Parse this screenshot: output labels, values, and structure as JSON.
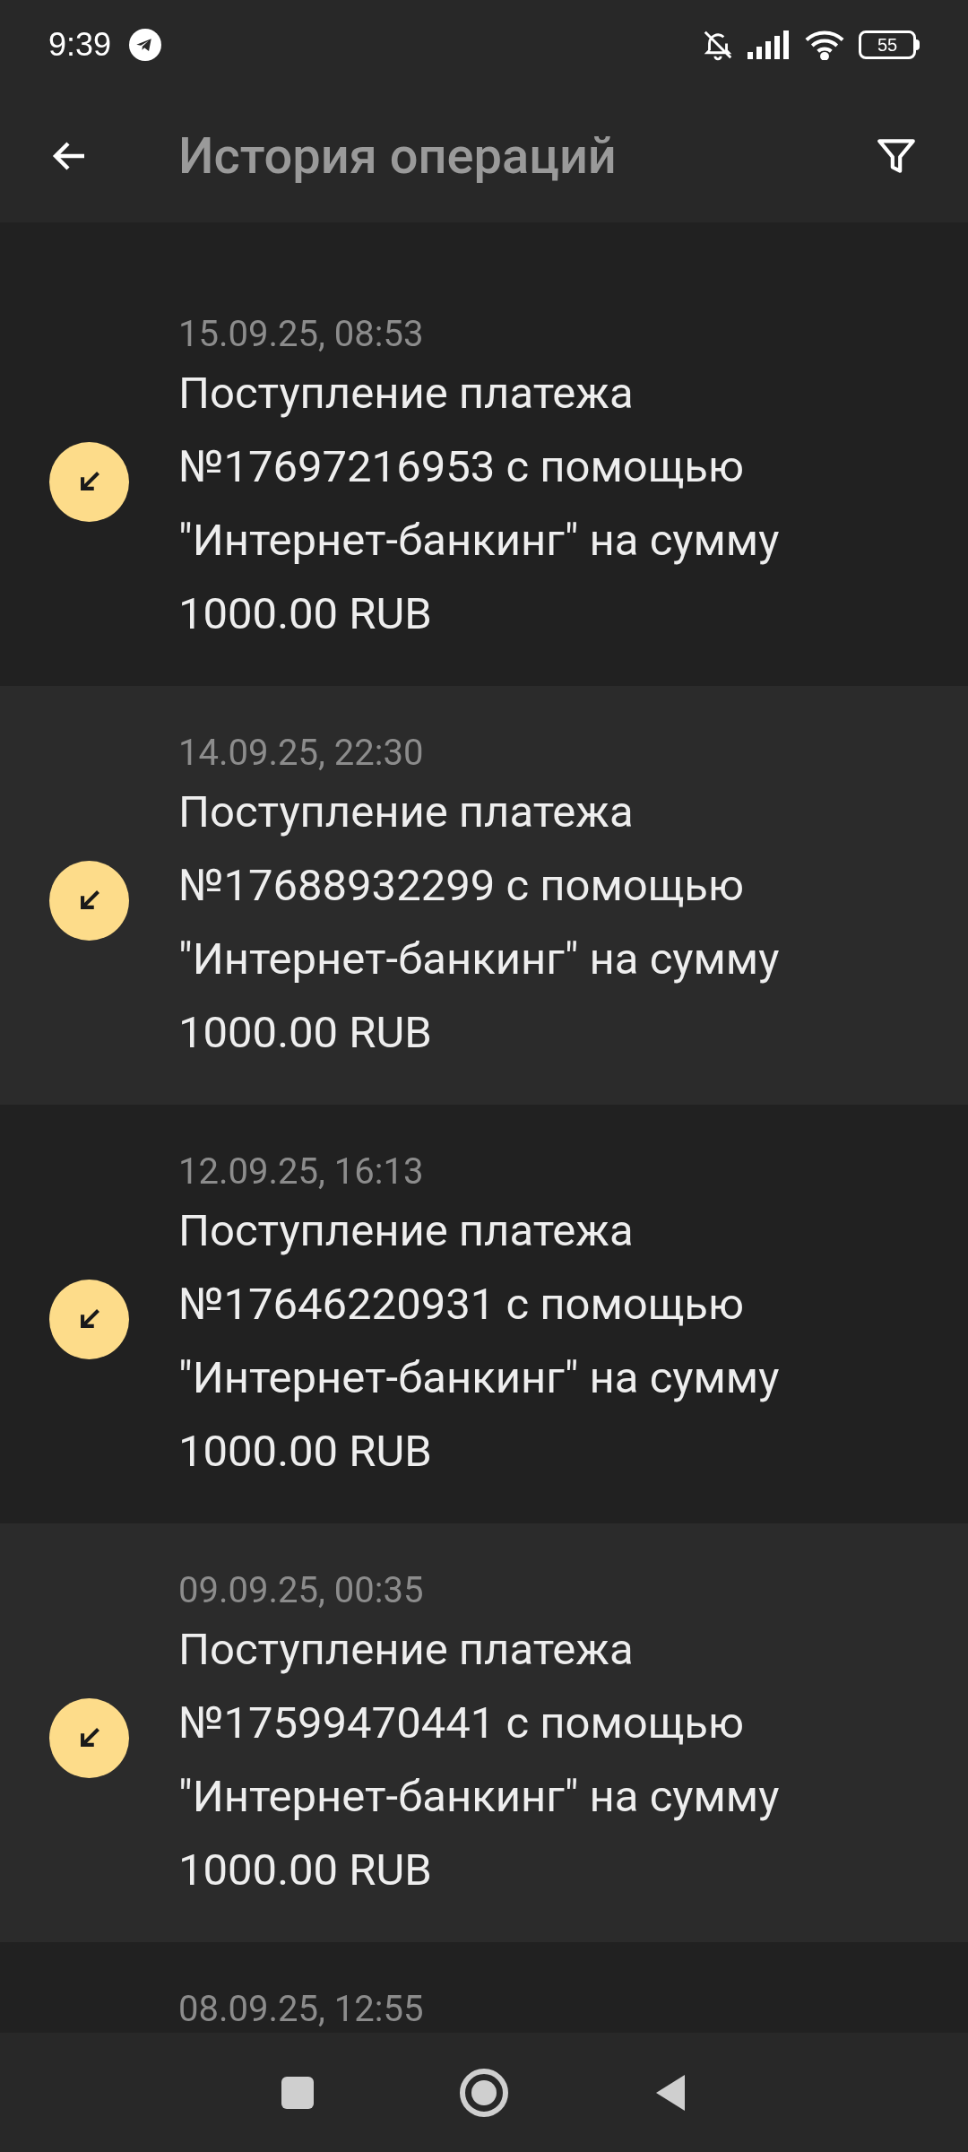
{
  "status_bar": {
    "time": "9:39",
    "battery": "55"
  },
  "header": {
    "title": "История операций"
  },
  "operations": [
    {
      "date": "15.09.25, 08:53",
      "text": "Поступление платежа №17697216953 с помощью \"Интернет-банкинг\" на сумму 1000.00 RUB"
    },
    {
      "date": "14.09.25, 22:30",
      "text": "Поступление платежа №17688932299 с помощью \"Интернет-банкинг\" на сумму 1000.00 RUB"
    },
    {
      "date": "12.09.25, 16:13",
      "text": "Поступление платежа №17646220931 с помощью \"Интернет-банкинг\" на сумму 1000.00 RUB"
    },
    {
      "date": "09.09.25, 00:35",
      "text": "Поступление платежа №17599470441 с помощью \"Интернет-банкинг\" на сумму 1000.00 RUB"
    },
    {
      "date": "08.09.25, 12:55"
    }
  ]
}
